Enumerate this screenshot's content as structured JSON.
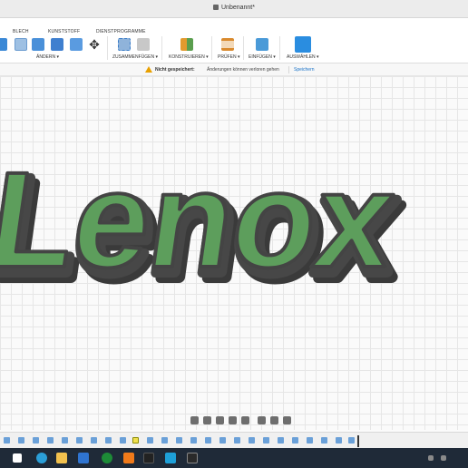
{
  "window": {
    "title": "Unbenannt*"
  },
  "tabs": [
    "BLECH",
    "KUNSTSTOFF",
    "DIENSTPROGRAMME"
  ],
  "groups": [
    "ÄNDERN ▾",
    "ZUSAMMENFÜGEN ▾",
    "KONSTRUIEREN ▾",
    "PRÜFEN ▾",
    "EINFÜGEN ▾",
    "AUSWÄHLEN ▾"
  ],
  "notice": {
    "title": "Nicht gespeichert:",
    "message": "Änderungen können verloren gehen",
    "action": "Speichern"
  },
  "model": {
    "text": "Lenox",
    "face_color": "#5d9e5c",
    "wall_color": "#4d4d4d"
  },
  "colors": {
    "accent": "#1a73c8",
    "warning": "#e8a000",
    "taskbar": "#1f2a38"
  }
}
